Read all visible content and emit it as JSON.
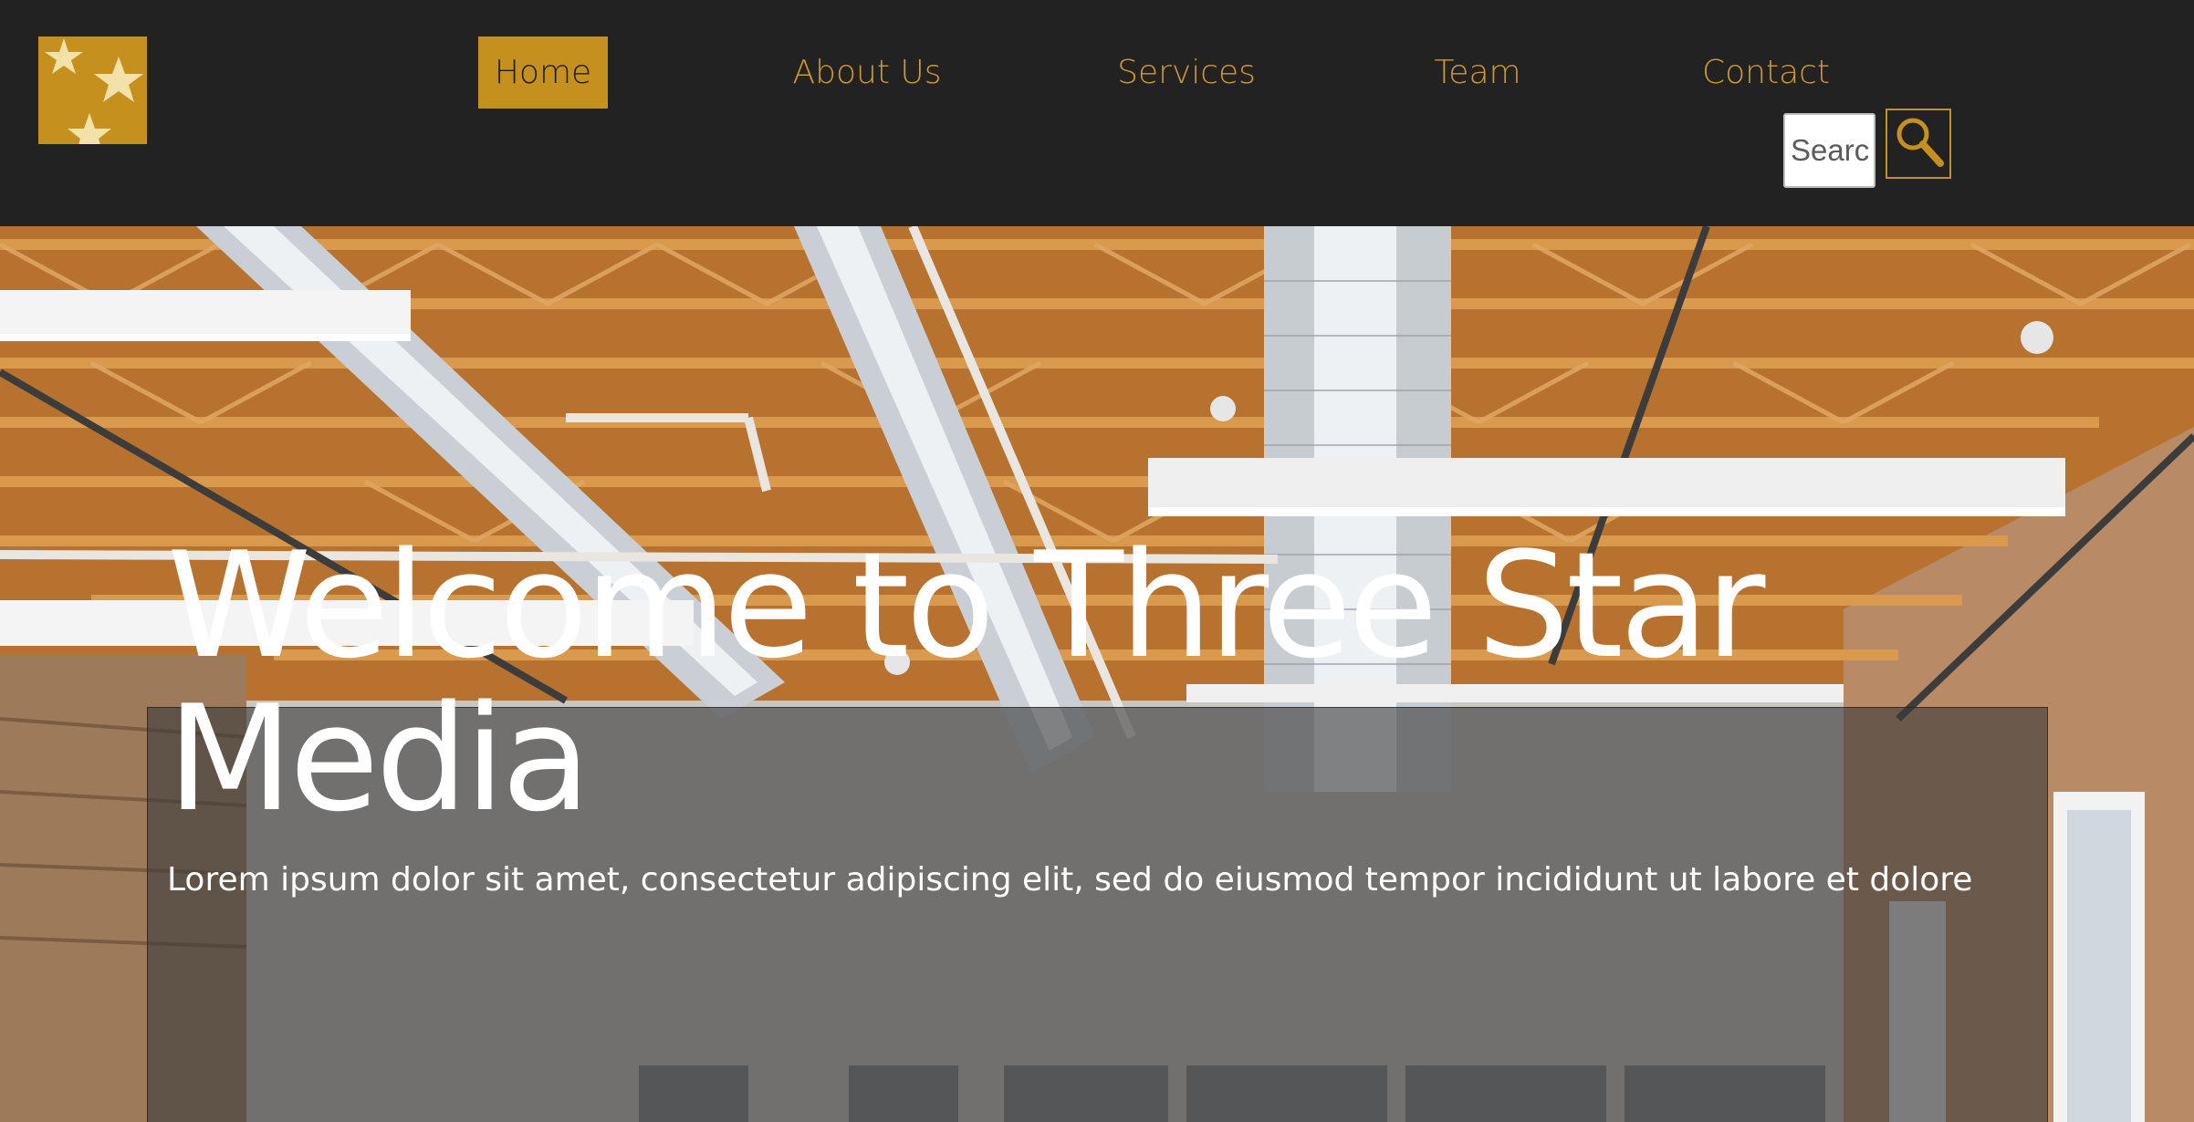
{
  "header": {
    "logo_icon": "three-stars-logo",
    "accent_color": "#c6901f",
    "background_color": "#222222"
  },
  "nav": {
    "items": [
      {
        "label": "Home",
        "active": true
      },
      {
        "label": "About Us",
        "active": false
      },
      {
        "label": "Services",
        "active": false
      },
      {
        "label": "Team",
        "active": false
      },
      {
        "label": "Contact",
        "active": false
      }
    ]
  },
  "search": {
    "placeholder": "Search",
    "button_icon": "magnifier-icon"
  },
  "hero": {
    "title": "Welcome to Three Star Media",
    "text": "Lorem ipsum dolor sit amet, consectetur adipiscing elit, sed do eiusmod tempor incididunt ut labore et dolore",
    "image": "office-ceiling-photo"
  }
}
